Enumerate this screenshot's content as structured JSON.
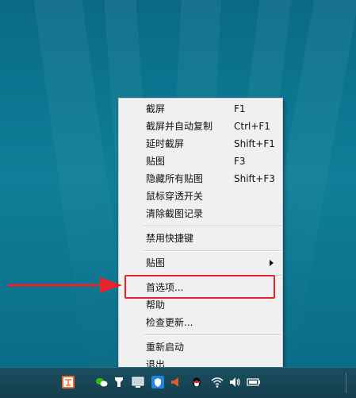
{
  "context_menu": {
    "groups": [
      [
        {
          "label": "截屏",
          "shortcut": "F1"
        },
        {
          "label": "截屏并自动复制",
          "shortcut": "Ctrl+F1"
        },
        {
          "label": "延时截屏",
          "shortcut": "Shift+F1"
        },
        {
          "label": "贴图",
          "shortcut": "F3"
        },
        {
          "label": "隐藏所有贴图",
          "shortcut": "Shift+F3"
        },
        {
          "label": "鼠标穿透开关",
          "shortcut": ""
        },
        {
          "label": "清除截图记录",
          "shortcut": ""
        }
      ],
      [
        {
          "label": "禁用快捷键",
          "shortcut": ""
        }
      ],
      [
        {
          "label": "贴图",
          "shortcut": "",
          "submenu": true
        }
      ],
      [
        {
          "label": "首选项...",
          "shortcut": "",
          "highlighted": true
        },
        {
          "label": "帮助",
          "shortcut": ""
        },
        {
          "label": "检查更新...",
          "shortcut": ""
        }
      ],
      [
        {
          "label": "重新启动",
          "shortcut": ""
        },
        {
          "label": "退出",
          "shortcut": ""
        }
      ]
    ]
  },
  "annotation": {
    "color": "#e8232b",
    "points_to": "首选项..."
  },
  "taskbar": {
    "tray_icons": [
      "snipaste-app-icon",
      "wechat-icon",
      "pinned-app-icon",
      "screen-icon",
      "shield-icon",
      "flag-icon",
      "qq-penguin-icon",
      "wifi-icon",
      "volume-icon",
      "battery-icon"
    ]
  },
  "colors": {
    "desktop": "#0b7590",
    "menu_bg": "#f0f0f0",
    "highlight": "#e8232b",
    "taskbar": "#173f4e"
  }
}
